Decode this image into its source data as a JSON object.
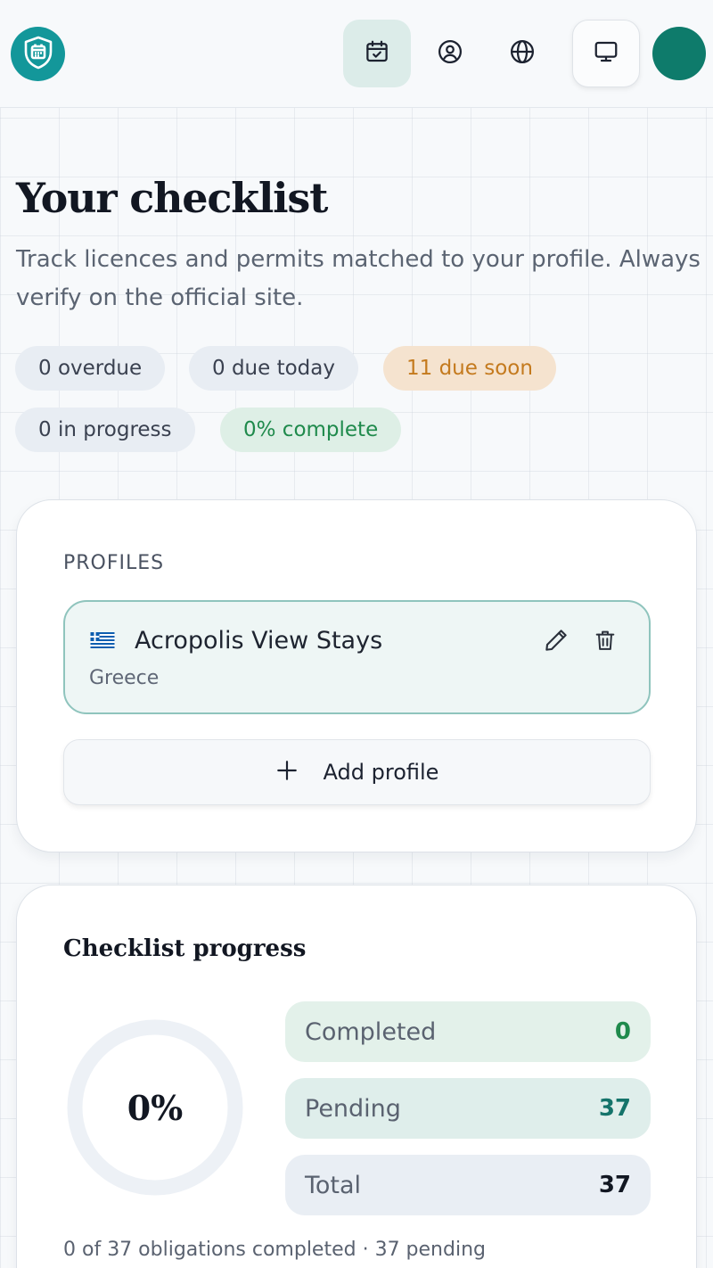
{
  "header": {
    "logo_icon": "shield-calendar-icon",
    "nav": [
      {
        "name": "checklist",
        "icon": "calendar-check-icon",
        "active": true
      },
      {
        "name": "profile",
        "icon": "user-circle-icon",
        "active": false
      },
      {
        "name": "language",
        "icon": "globe-icon",
        "active": false
      },
      {
        "name": "display",
        "icon": "monitor-icon",
        "active": false
      }
    ]
  },
  "page": {
    "title": "Your checklist",
    "subtitle": "Track licences and permits matched to your profile. Always verify on the official site."
  },
  "badges": {
    "overdue": "0 overdue",
    "due_today": "0 due today",
    "due_soon": "11 due soon",
    "in_progress": "0 in progress",
    "complete": "0% complete"
  },
  "profiles": {
    "section_label": "PROFILES",
    "items": [
      {
        "name": "Acropolis View Stays",
        "country": "Greece",
        "flag": "greece-flag"
      }
    ],
    "add_label": "Add profile"
  },
  "progress": {
    "title": "Checklist progress",
    "percent_label": "0%",
    "percent": 0,
    "stats": {
      "completed_label": "Completed",
      "completed_value": "0",
      "pending_label": "Pending",
      "pending_value": "37",
      "total_label": "Total",
      "total_value": "37"
    },
    "summary": "0 of 37 obligations completed · 37 pending"
  },
  "colors": {
    "accent": "#13979a",
    "avatar": "#0e7b6b",
    "warning": "#c47a1e",
    "success": "#1f8a4c"
  }
}
